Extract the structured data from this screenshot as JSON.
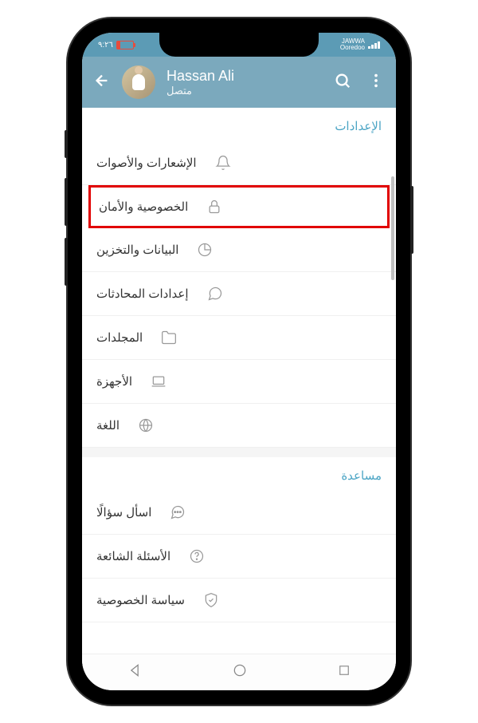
{
  "status": {
    "left_text": "٩:٢٦",
    "carrier": "JAWWA",
    "carrier2": "Ooredoo"
  },
  "header": {
    "name": "Hassan Ali",
    "status": "متصل"
  },
  "sections": {
    "settings_title": "الإعدادات",
    "help_title": "مساعدة"
  },
  "settings": {
    "notifications": "الإشعارات والأصوات",
    "privacy": "الخصوصية والأمان",
    "data": "البيانات والتخزين",
    "chats": "إعدادات المحادثات",
    "folders": "المجلدات",
    "devices": "الأجهزة",
    "language": "اللغة"
  },
  "help": {
    "ask": "اسأل سؤالًا",
    "faq": "الأسئلة الشائعة",
    "privacy_policy": "سياسة الخصوصية"
  }
}
